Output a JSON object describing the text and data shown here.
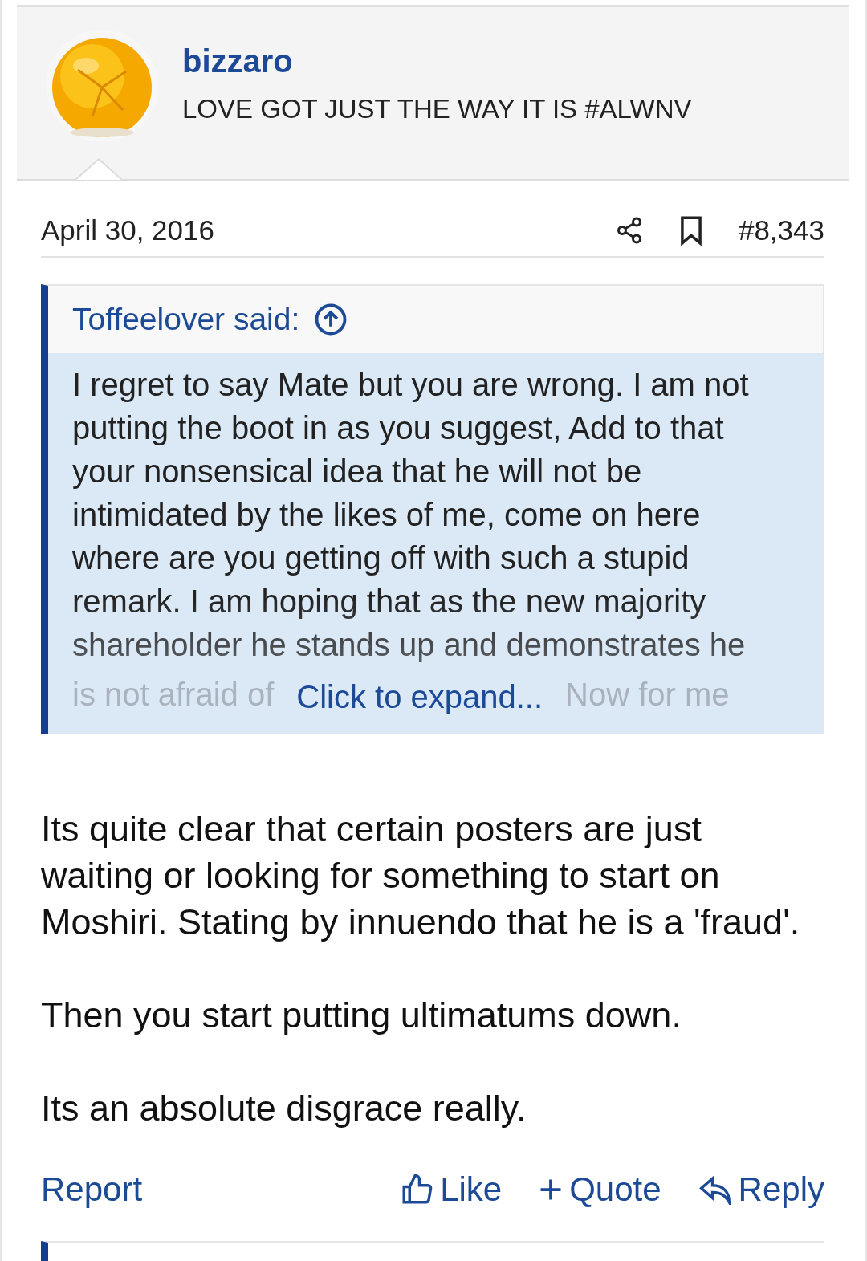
{
  "author": {
    "name": "bizzaro",
    "title": "LOVE GOT JUST THE WAY IT IS #ALWNV"
  },
  "post_meta": {
    "date": "April 30, 2016",
    "number": "#8,343"
  },
  "quote": {
    "attribution": "Toffeelover said:",
    "text": "I regret to say Mate but you are wrong. I am not putting the boot in as you suggest, Add to that your nonsensical idea that he will not be intimidated by the likes of me, come on here where are you getting off with such a stupid remark. I am hoping that as the new majority shareholder he stands up and demonstrates he",
    "faded_start": "is not afraid of",
    "expand": "Click to expand...",
    "faded_end": "Now for me"
  },
  "body": [
    "Its quite clear that certain posters are just waiting or looking for something to start on Moshiri. Stating by innuendo that he is a 'fraud'.",
    "Then you start putting ultimatums down.",
    "Its an absolute disgrace really."
  ],
  "actions": {
    "report": "Report",
    "like": "Like",
    "quote": "Quote",
    "reply": "Reply"
  }
}
